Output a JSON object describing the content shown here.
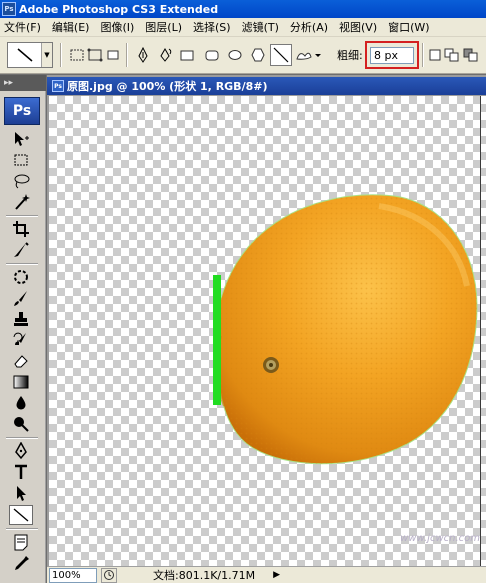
{
  "window": {
    "app_icon": "Ps",
    "title": "Adobe Photoshop CS3 Extended"
  },
  "menu": [
    {
      "label": "文件(F)"
    },
    {
      "label": "编辑(E)"
    },
    {
      "label": "图像(I)"
    },
    {
      "label": "图层(L)"
    },
    {
      "label": "选择(S)"
    },
    {
      "label": "滤镜(T)"
    },
    {
      "label": "分析(A)"
    },
    {
      "label": "视图(V)"
    },
    {
      "label": "窗口(W)"
    }
  ],
  "options": {
    "weight_label": "粗细:",
    "weight_value": "8 px",
    "highlight_color": "#d42020"
  },
  "toolbox": {
    "logo": "Ps",
    "grip": "▸▸"
  },
  "document": {
    "icon": "Ps",
    "title": "原图.jpg @ 100% (形状 1, RGB/8#)",
    "zoom": "100%",
    "doc_info": "文档:801.1K/1.71M",
    "watermark": "www.jcwcn.com",
    "line_color": "#22dd22",
    "orange_color": "#f0a020"
  }
}
